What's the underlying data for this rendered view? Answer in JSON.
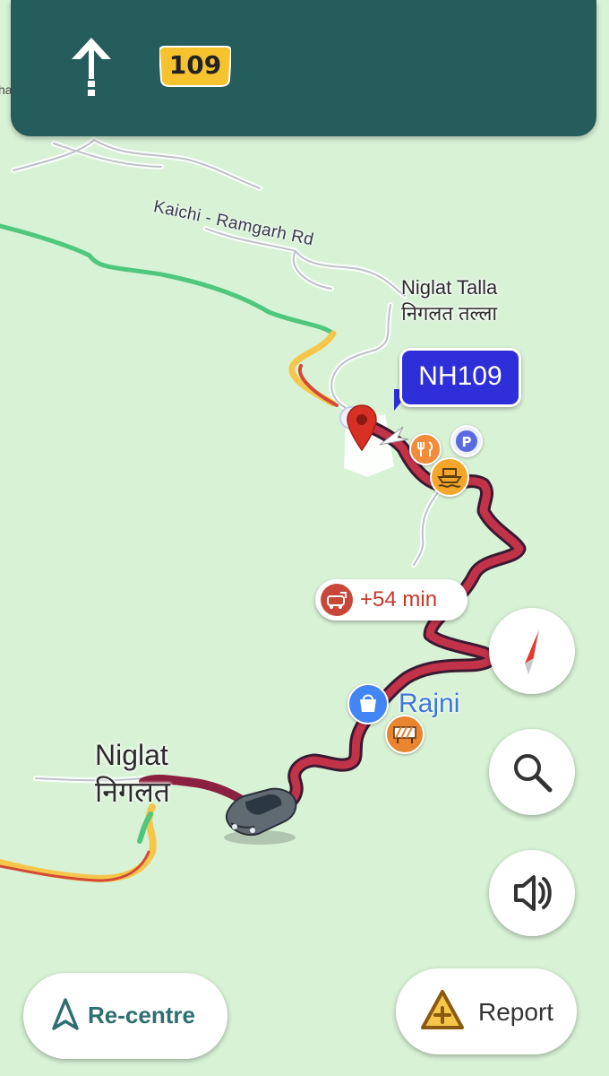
{
  "nav": {
    "direction_icon": "straight-arrow-icon",
    "route_shield": "109",
    "edge_fragment": "ha"
  },
  "map": {
    "road_label": "Kaichi - Ramgarh Rd",
    "places": {
      "niglat_talla": {
        "name_en": "Niglat Talla",
        "name_hi": "निगलत तल्ला"
      },
      "niglat": {
        "name_en": "Niglat",
        "name_hi": "निगलत"
      }
    },
    "highway_callout": "NH109",
    "delay": {
      "icon": "traffic-car-icon",
      "text": "+54 min"
    },
    "poi_label": "Rajni",
    "markers": [
      {
        "name": "destination-pin-icon",
        "color": "#d93025"
      },
      {
        "name": "restaurant-icon",
        "color": "#f28b3a"
      },
      {
        "name": "parking-icon",
        "color": "#5a6be0"
      },
      {
        "name": "ferry-icon",
        "color": "#f4a62a"
      },
      {
        "name": "shopping-icon",
        "color": "#4285f4"
      },
      {
        "name": "road-closure-icon",
        "color": "#e8852e"
      }
    ]
  },
  "controls": {
    "compass": "compass-icon",
    "search": "search-icon",
    "sound": "speaker-icon",
    "recenter_label": "Re-centre",
    "report_label": "Report"
  },
  "colors": {
    "header": "#255c5c",
    "map_background": "#d8f2d6",
    "traffic_heavy": "#c2334a",
    "traffic_slow": "#f6c64a",
    "traffic_free": "#4fc77f",
    "route_dark": "#8c2040",
    "accent": "#2f6f6f"
  }
}
